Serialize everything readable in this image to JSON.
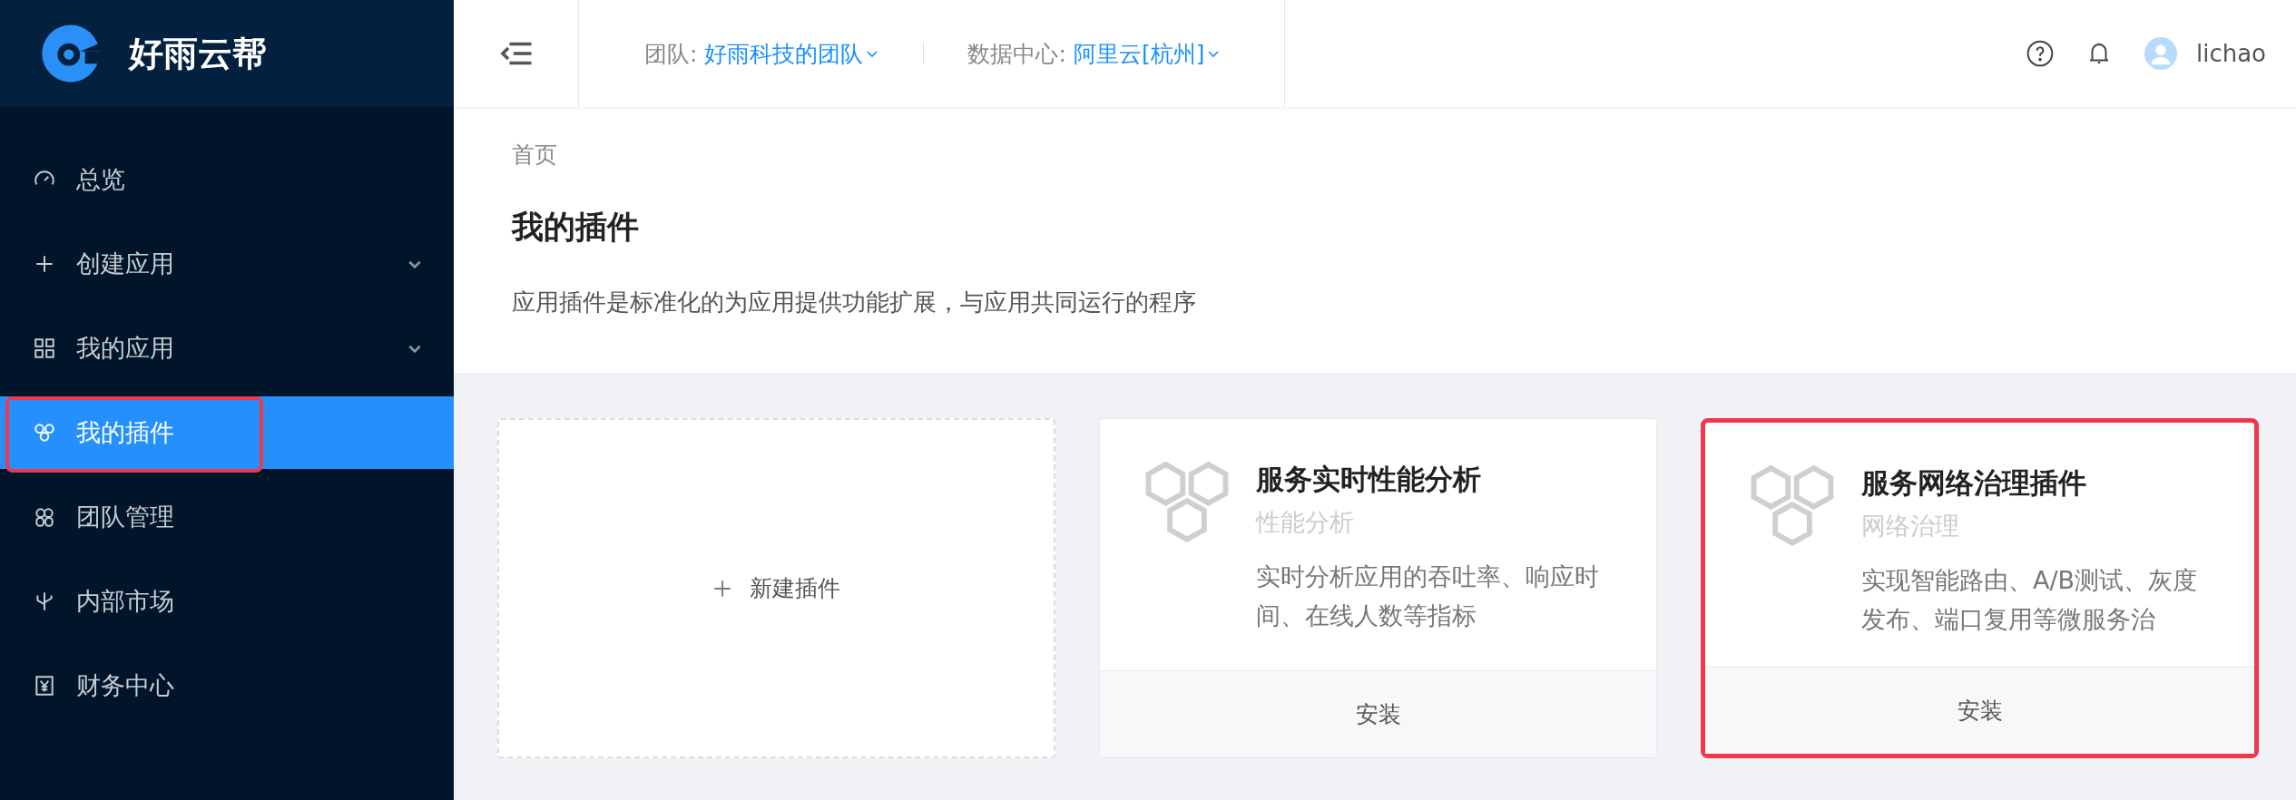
{
  "brand": {
    "name": "好雨云帮"
  },
  "sidebar": {
    "items": [
      {
        "label": "总览",
        "kind": "gauge",
        "expandable": false,
        "selected": false,
        "highlighted": false
      },
      {
        "label": "创建应用",
        "kind": "plus",
        "expandable": true,
        "selected": false,
        "highlighted": false
      },
      {
        "label": "我的应用",
        "kind": "grid",
        "expandable": true,
        "selected": false,
        "highlighted": false
      },
      {
        "label": "我的插件",
        "kind": "hex",
        "expandable": false,
        "selected": true,
        "highlighted": true
      },
      {
        "label": "团队管理",
        "kind": "team",
        "expandable": false,
        "selected": false,
        "highlighted": false
      },
      {
        "label": "内部市场",
        "kind": "fork",
        "expandable": false,
        "selected": false,
        "highlighted": false
      },
      {
        "label": "财务中心",
        "kind": "yen",
        "expandable": false,
        "selected": false,
        "highlighted": false
      }
    ]
  },
  "header": {
    "team_label": "团队:",
    "team": "好雨科技的团队",
    "datacenter_label": "数据中心:",
    "datacenter": "阿里云[杭州]",
    "user": "lichao"
  },
  "page": {
    "breadcrumb": "首页",
    "title": "我的插件",
    "description": "应用插件是标准化的为应用提供功能扩展，与应用共同运行的程序"
  },
  "new_plugin": {
    "label": "新建插件"
  },
  "plugins": [
    {
      "name": "服务实时性能分析",
      "category": "性能分析",
      "description": "实时分析应用的吞吐率、响应时间、在线人数等指标",
      "action": "安装",
      "highlighted": false
    },
    {
      "name": "服务网络治理插件",
      "category": "网络治理",
      "description": "实现智能路由、A/B测试、灰度发布、端口复用等微服务治",
      "action": "安装",
      "highlighted": true
    }
  ]
}
